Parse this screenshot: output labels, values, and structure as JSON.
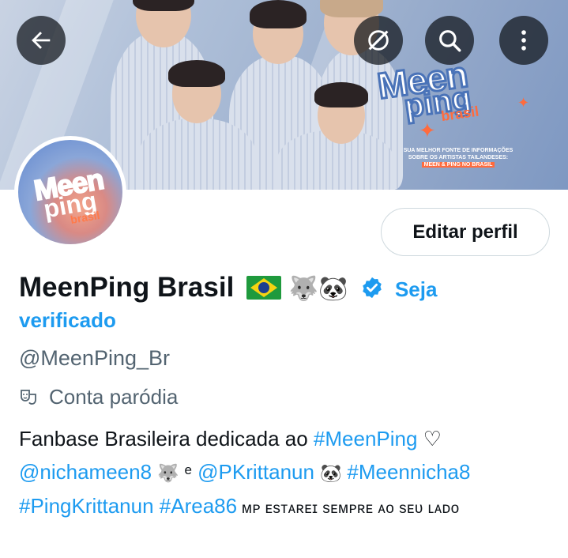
{
  "header": {
    "back_icon": "arrow-left-icon",
    "grok_icon": "grok-icon",
    "search_icon": "search-icon",
    "more_icon": "more-vertical-icon"
  },
  "banner": {
    "logo_line1": "Meen",
    "logo_line2": "ping",
    "logo_line3": "brasil",
    "caption_line1": "SUA MELHOR FONTE DE INFORMAÇÕES",
    "caption_line2": "SOBRE OS ARTISTAS TAILANDESES:",
    "caption_line3": "MEEN & PING NO BRASIL"
  },
  "avatar": {
    "line1": "Meen",
    "line2": "ping",
    "line3": "brasil"
  },
  "profile": {
    "edit_label": "Editar perfil",
    "display_name": "MeenPing Brasil",
    "name_emojis": "🐺🐼",
    "verify_link_part1": "Seja",
    "verify_link_part2": "verificado",
    "handle": "@MeenPing_Br",
    "parody_label": "Conta paródia",
    "bio": {
      "text1": "Fanbase Brasileira dedicada ao ",
      "tag_meenping": "#MeenPing",
      "heart": " ♡",
      "mention_nichameen": "@nichameen8",
      "emoji_wolf": " 🐺 ",
      "conj": "e",
      "mention_pkrittanun": "@PKrittanun",
      "emoji_panda": " 🐼  ",
      "tag_meennicha": "#Meennicha8",
      "tag_pingkrittanun": "#PingKrittanun",
      "tag_area86": "#Area86",
      "caps_text": " ᴍᴘ ᴇsᴛᴀʀᴇɪ sᴇᴍᴘʀᴇ ᴀᴏ sᴇᴜ ʟᴀᴅᴏ"
    }
  },
  "colors": {
    "link": "#1d9bf0",
    "text": "#0f1419",
    "muted": "#536471",
    "border": "#cfd9de"
  }
}
